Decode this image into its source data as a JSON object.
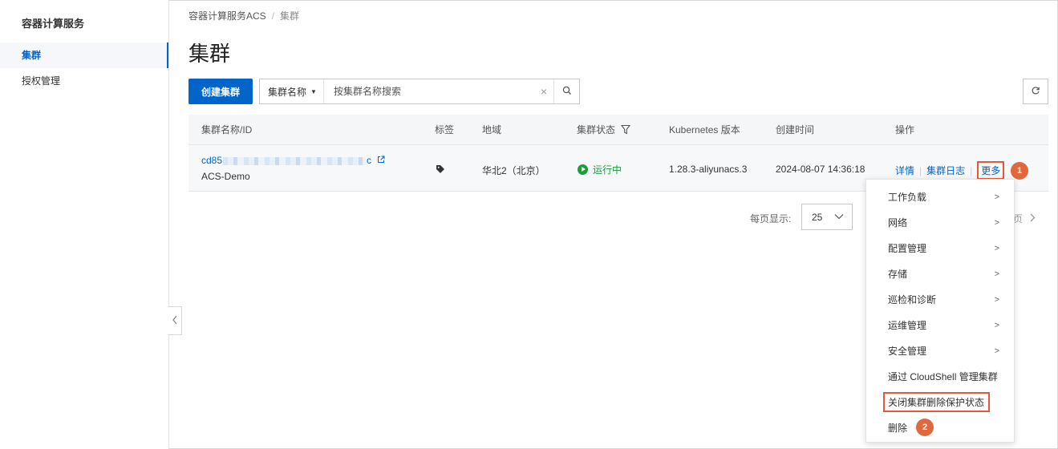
{
  "sidebar": {
    "title": "容器计算服务",
    "items": [
      {
        "label": "集群",
        "active": true
      },
      {
        "label": "授权管理",
        "active": false
      }
    ]
  },
  "breadcrumb": {
    "root": "容器计算服务ACS",
    "separator": "/",
    "current": "集群"
  },
  "page_title": "集群",
  "toolbar": {
    "create_label": "创建集群",
    "search_field": "集群名称",
    "search_placeholder": "按集群名称搜索"
  },
  "table": {
    "headers": [
      "集群名称/ID",
      "标签",
      "地域",
      "集群状态",
      "Kubernetes 版本",
      "创建时间",
      "操作"
    ],
    "rows": [
      {
        "id_prefix": "cd85",
        "id_suffix": "c",
        "name": "ACS-Demo",
        "region": "华北2（北京）",
        "status": "运行中",
        "version": "1.28.3-aliyunacs.3",
        "created": "2024-08-07 14:36:18",
        "actions": [
          "详情",
          "集群日志",
          "更多"
        ]
      }
    ]
  },
  "pagination": {
    "page_size_label": "每页显示:",
    "page_size": "25",
    "next_label": "页"
  },
  "menu": {
    "items": [
      {
        "label": "工作负载",
        "submenu": true
      },
      {
        "label": "网络",
        "submenu": true
      },
      {
        "label": "配置管理",
        "submenu": true
      },
      {
        "label": "存储",
        "submenu": true
      },
      {
        "label": "巡检和诊断",
        "submenu": true
      },
      {
        "label": "运维管理",
        "submenu": true
      },
      {
        "label": "安全管理",
        "submenu": true
      },
      {
        "label": "通过 CloudShell 管理集群",
        "submenu": false
      },
      {
        "label": "关闭集群删除保护状态",
        "submenu": false
      },
      {
        "label": "删除",
        "submenu": false
      }
    ]
  },
  "annotations": {
    "step1": "1",
    "step2": "2"
  },
  "colors": {
    "primary": "#0064c8",
    "success": "#1f9a3c",
    "highlight": "#e6573b",
    "badge": "#e0683f"
  },
  "icons": [
    "search-icon",
    "refresh-icon",
    "clear-icon",
    "filter-icon",
    "tag-icon",
    "external-link-icon",
    "chevron-down-icon",
    "chevron-right-icon",
    "chevron-left-icon"
  ]
}
